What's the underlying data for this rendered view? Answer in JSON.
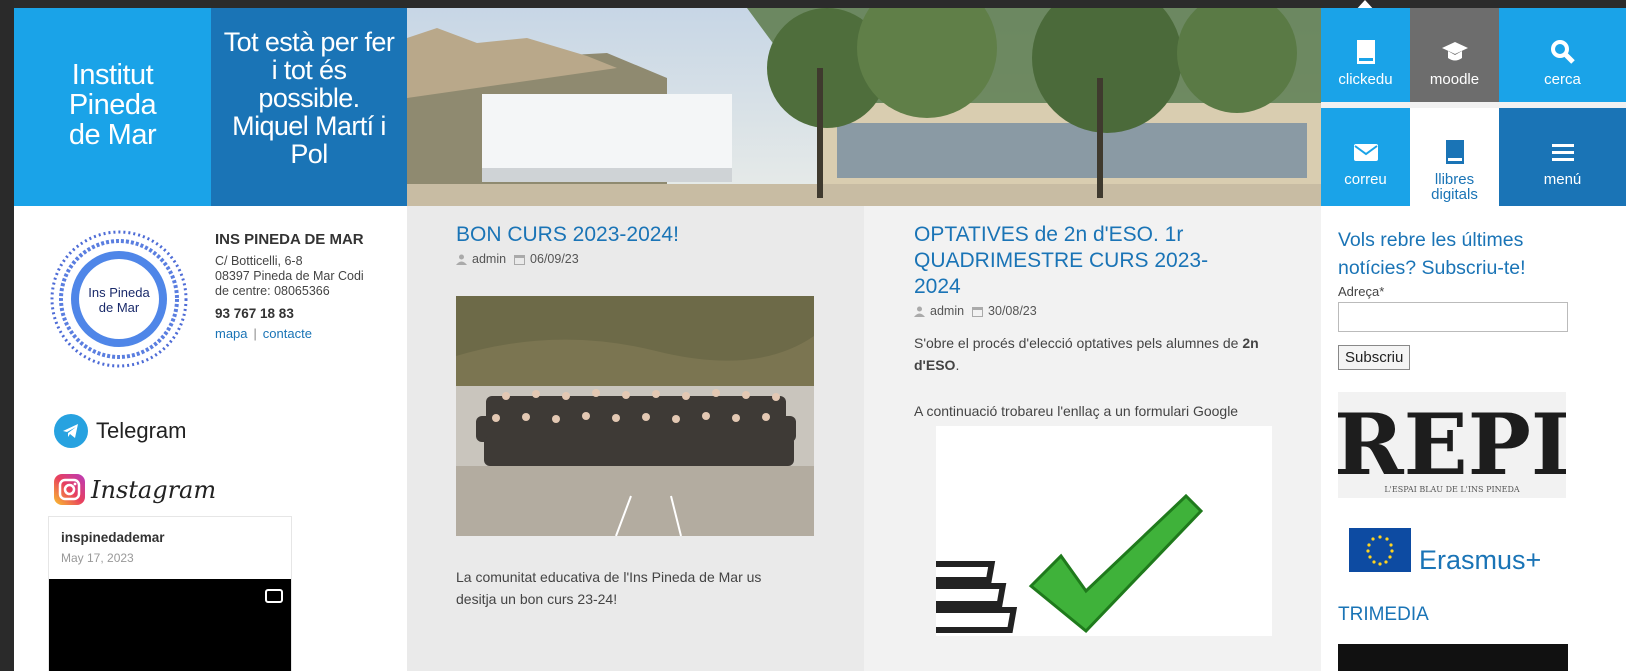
{
  "header": {
    "logo_lines": [
      "Institut",
      "Pineda",
      "de Mar"
    ],
    "quote_lines": [
      "Tot està per fer",
      "i tot és",
      "possible.",
      "Miquel Martí i",
      "Pol"
    ],
    "tiles": [
      {
        "label": "clickedu",
        "icon": "book-icon"
      },
      {
        "label": "moodle",
        "icon": "graduation-cap-icon"
      },
      {
        "label": "cerca",
        "icon": "search-icon"
      },
      {
        "label": "correu",
        "icon": "envelope-icon"
      },
      {
        "label_lines": [
          "llibres",
          "digitals"
        ],
        "icon": "book-icon"
      },
      {
        "label": "menú",
        "icon": "hamburger-icon"
      }
    ]
  },
  "school": {
    "seal_lines": [
      "Ins Pineda",
      "de Mar"
    ],
    "name": "INS PINEDA DE MAR",
    "address_lines": [
      "C/ Botticelli, 6-8",
      "08397 Pineda de Mar Codi",
      "de centre: 08065366"
    ],
    "phone": "93 767 18 83",
    "links": [
      "mapa",
      "contacte"
    ],
    "separator": "|"
  },
  "social": {
    "telegram": "Telegram",
    "instagram": "Instagram",
    "feed_user": "inspinedademar",
    "feed_date": "May 17, 2023"
  },
  "posts": [
    {
      "title": "BON CURS 2023-2024!",
      "author": "admin",
      "date": "06/09/23",
      "body_lines": [
        "La comunitat educativa de l'Ins Pineda de Mar us",
        "desitja un bon curs 23-24!"
      ]
    },
    {
      "title_lines": [
        "OPTATIVES de 2n d'ESO. 1r",
        "QUADRIMESTRE CURS 2023-",
        "2024"
      ],
      "author": "admin",
      "date": "30/08/23",
      "body_line1": "S'obre el procés d'elecció optatives pels alumnes de",
      "body_bold": "2n d'ESO",
      "body_end": ".",
      "body2": "A continuació trobareu l'enllaç a un formulari Google"
    }
  ],
  "newsletter": {
    "heading_lines": [
      "Vols rebre les últimes",
      "notícies? Subscriu-te!"
    ],
    "field_label": "Adreça*",
    "button": "Subscriu"
  },
  "sidebar": {
    "repi_title": "REPI",
    "repi_subtitle": "L'ESPAI BLAU DE L'INS PINEDA",
    "erasmus": "Erasmus+",
    "trimedia": "TRIMEDIA"
  },
  "colors": {
    "accent": "#1aa3e8",
    "dark_blue": "#1a74b6",
    "grey_tile": "#6d6d6d"
  }
}
